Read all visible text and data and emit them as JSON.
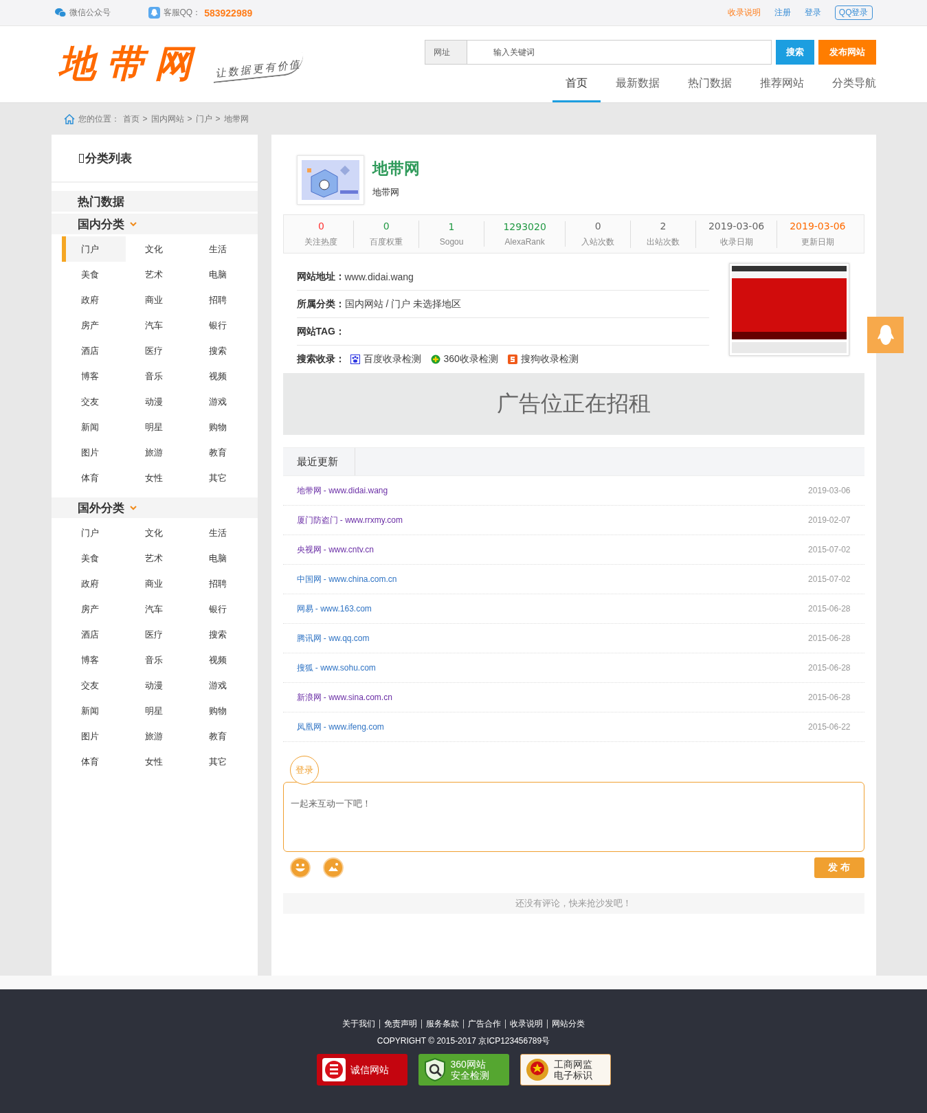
{
  "top_bar": {
    "wechat": "微信公众号",
    "qq_label": "客服QQ：",
    "qq_number": "583922989",
    "links": [
      {
        "label": "收录说明",
        "kind": "highlight"
      },
      {
        "label": "注册",
        "kind": "plain"
      },
      {
        "label": "登录",
        "kind": "plain"
      },
      {
        "label": "QQ登录",
        "kind": "outlined"
      }
    ]
  },
  "header": {
    "logo": "地带网",
    "slogan": "让数据更有价值",
    "search": {
      "scope": "网址",
      "placeholder": "输入关键词",
      "button": "搜索"
    },
    "publish_button": "发布网站",
    "nav": [
      {
        "label": "首页",
        "selected": true
      },
      {
        "label": "最新数据",
        "selected": false
      },
      {
        "label": "热门数据",
        "selected": false
      },
      {
        "label": "推荐网站",
        "selected": false
      },
      {
        "label": "分类导航",
        "selected": false
      }
    ]
  },
  "breadcrumb": {
    "label": "您的位置：",
    "separator": ">",
    "items": [
      "首页",
      "国内网站",
      "门户",
      "地带网"
    ]
  },
  "sidebar": {
    "title": "分类列表",
    "hot": "热门数据",
    "groups": [
      {
        "title": "国内分类",
        "items": [
          {
            "label": "门户",
            "selected": true
          },
          {
            "label": "文化",
            "selected": false
          },
          {
            "label": "生活",
            "selected": false
          },
          {
            "label": "美食",
            "selected": false
          },
          {
            "label": "艺术",
            "selected": false
          },
          {
            "label": "电脑",
            "selected": false
          },
          {
            "label": "政府",
            "selected": false
          },
          {
            "label": "商业",
            "selected": false
          },
          {
            "label": "招聘",
            "selected": false
          },
          {
            "label": "房产",
            "selected": false
          },
          {
            "label": "汽车",
            "selected": false
          },
          {
            "label": "银行",
            "selected": false
          },
          {
            "label": "酒店",
            "selected": false
          },
          {
            "label": "医疗",
            "selected": false
          },
          {
            "label": "搜索",
            "selected": false
          },
          {
            "label": "博客",
            "selected": false
          },
          {
            "label": "音乐",
            "selected": false
          },
          {
            "label": "视频",
            "selected": false
          },
          {
            "label": "交友",
            "selected": false
          },
          {
            "label": "动漫",
            "selected": false
          },
          {
            "label": "游戏",
            "selected": false
          },
          {
            "label": "新闻",
            "selected": false
          },
          {
            "label": "明星",
            "selected": false
          },
          {
            "label": "购物",
            "selected": false
          },
          {
            "label": "图片",
            "selected": false
          },
          {
            "label": "旅游",
            "selected": false
          },
          {
            "label": "教育",
            "selected": false
          },
          {
            "label": "体育",
            "selected": false
          },
          {
            "label": "女性",
            "selected": false
          },
          {
            "label": "其它",
            "selected": false
          }
        ]
      },
      {
        "title": "国外分类",
        "items": [
          {
            "label": "门户",
            "selected": false
          },
          {
            "label": "文化",
            "selected": false
          },
          {
            "label": "生活",
            "selected": false
          },
          {
            "label": "美食",
            "selected": false
          },
          {
            "label": "艺术",
            "selected": false
          },
          {
            "label": "电脑",
            "selected": false
          },
          {
            "label": "政府",
            "selected": false
          },
          {
            "label": "商业",
            "selected": false
          },
          {
            "label": "招聘",
            "selected": false
          },
          {
            "label": "房产",
            "selected": false
          },
          {
            "label": "汽车",
            "selected": false
          },
          {
            "label": "银行",
            "selected": false
          },
          {
            "label": "酒店",
            "selected": false
          },
          {
            "label": "医疗",
            "selected": false
          },
          {
            "label": "搜索",
            "selected": false
          },
          {
            "label": "博客",
            "selected": false
          },
          {
            "label": "音乐",
            "selected": false
          },
          {
            "label": "视频",
            "selected": false
          },
          {
            "label": "交友",
            "selected": false
          },
          {
            "label": "动漫",
            "selected": false
          },
          {
            "label": "游戏",
            "selected": false
          },
          {
            "label": "新闻",
            "selected": false
          },
          {
            "label": "明星",
            "selected": false
          },
          {
            "label": "购物",
            "selected": false
          },
          {
            "label": "图片",
            "selected": false
          },
          {
            "label": "旅游",
            "selected": false
          },
          {
            "label": "教育",
            "selected": false
          },
          {
            "label": "体育",
            "selected": false
          },
          {
            "label": "女性",
            "selected": false
          },
          {
            "label": "其它",
            "selected": false
          }
        ]
      }
    ]
  },
  "site": {
    "name": "地带网",
    "subtitle": "地带网",
    "stats": [
      {
        "value": "0",
        "label": "关注热度",
        "color": "#ff3333"
      },
      {
        "value": "0",
        "label": "百度权重",
        "color": "#229944"
      },
      {
        "value": "1",
        "label": "Sogou",
        "color": "#229944"
      },
      {
        "value": "1293020",
        "label": "AlexaRank",
        "color": "#229944"
      },
      {
        "value": "0",
        "label": "入站次数",
        "color": "#666666"
      },
      {
        "value": "2",
        "label": "出站次数",
        "color": "#666666"
      },
      {
        "value": "2019-03-06",
        "label": "收录日期",
        "color": "#666666"
      },
      {
        "value": "2019-03-06",
        "label": "更新日期",
        "color": "#ff6a00"
      }
    ],
    "info": [
      {
        "label": "网站地址：",
        "value": "www.didai.wang"
      },
      {
        "label": "所属分类：",
        "value": "国内网站 / 门户 未选择地区"
      },
      {
        "label": "网站TAG："
      }
    ],
    "search_label": "搜索收录：",
    "search_links": [
      {
        "label": "百度收录检测",
        "kind": "baidu"
      },
      {
        "label": "360收录检测",
        "kind": "qihoo"
      },
      {
        "label": "搜狗收录检测",
        "kind": "sogou"
      }
    ]
  },
  "ad_banner": "广告位正在招租",
  "recent": {
    "title": "最近更新",
    "rows": [
      {
        "name": "地带网 - www.didai.wang",
        "date": "2019-03-06",
        "visited": true
      },
      {
        "name": "厦门防盗门 - www.rrxmy.com",
        "date": "2019-02-07",
        "visited": true
      },
      {
        "name": "央视网 - www.cntv.cn",
        "date": "2015-07-02",
        "visited": true
      },
      {
        "name": "中国网 - www.china.com.cn",
        "date": "2015-07-02",
        "visited": false
      },
      {
        "name": "网易 - www.163.com",
        "date": "2015-06-28",
        "visited": false
      },
      {
        "name": "腾讯网 - ww.qq.com",
        "date": "2015-06-28",
        "visited": false
      },
      {
        "name": "搜狐 - www.sohu.com",
        "date": "2015-06-28",
        "visited": false
      },
      {
        "name": "新浪网 - www.sina.com.cn",
        "date": "2015-06-28",
        "visited": true
      },
      {
        "name": "凤凰网 - www.ifeng.com",
        "date": "2015-06-22",
        "visited": false
      }
    ]
  },
  "comment": {
    "login_tab": "登录",
    "placeholder": "一起来互动一下吧！",
    "submit": "发 布",
    "empty": "还没有评论，快来抢沙发吧！"
  },
  "footer": {
    "links": [
      "关于我们",
      "免责声明",
      "服务条款",
      "广告合作",
      "收录说明",
      "网站分类"
    ],
    "copyright": "COPYRIGHT © 2015-2017 京ICP123456789号",
    "badges": [
      {
        "kind": "trust",
        "lines": [
          "诚信网站"
        ]
      },
      {
        "kind": "security",
        "lines": [
          "360网站",
          "安全检测"
        ]
      },
      {
        "kind": "gov",
        "lines": [
          "工商网监",
          "电子标识"
        ]
      }
    ]
  }
}
